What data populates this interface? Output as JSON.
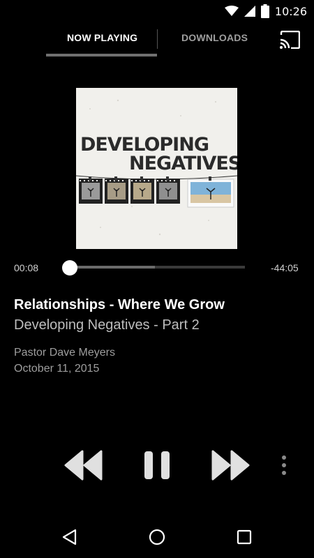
{
  "status_bar": {
    "time": "10:26"
  },
  "tabs": [
    {
      "label": "NOW PLAYING",
      "active": true
    },
    {
      "label": "DOWNLOADS",
      "active": false
    }
  ],
  "album_art": {
    "title_line1": "DEVELOPING",
    "title_line2": "NEGATIVES"
  },
  "player": {
    "elapsed": "00:08",
    "remaining": "-44:05",
    "progress": 0.003,
    "buffered": 0.49
  },
  "track": {
    "title": "Relationships - Where We Grow",
    "series": "Developing Negatives - Part 2",
    "speaker": "Pastor Dave Meyers",
    "date": "October 11, 2015"
  },
  "icons": {
    "status": [
      "wifi-icon",
      "signal-icon",
      "battery-icon"
    ],
    "toolbar": [
      "cast-icon"
    ],
    "controls": [
      "rewind-icon",
      "pause-icon",
      "fast-forward-icon",
      "more-vert-icon"
    ],
    "navigation": [
      "back-icon",
      "home-icon",
      "recents-icon"
    ]
  },
  "colors": {
    "background": "#000000",
    "tab_indicator": "#707070",
    "text_primary": "#ffffff",
    "text_secondary": "#bdbdbd",
    "text_tertiary": "#9e9e9e",
    "control": "#e0e0e0"
  }
}
